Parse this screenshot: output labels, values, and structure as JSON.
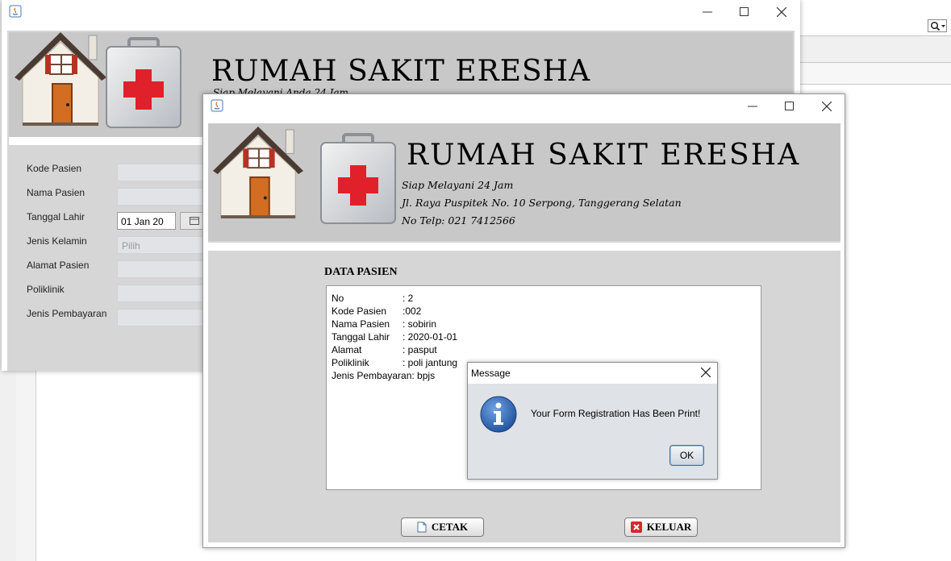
{
  "colors": {
    "panel": "#c8c8c8",
    "cross": "#e0202a",
    "info_blue": "#2f6fc4"
  },
  "back_window": {
    "hospital_name": "RUMAH SAKIT ERESHA",
    "tagline_partial": "Siap Melayani Anda 24 Jam",
    "form": {
      "labels": [
        "Kode Pasien",
        "Nama Pasien",
        "Tanggal Lahir",
        "Jenis Kelamin",
        "Alamat Pasien",
        "Poliklinik",
        "Jenis Pembayaran"
      ],
      "date_value": "01 Jan 20",
      "gender_placeholder": "Pilih"
    }
  },
  "front_window": {
    "hospital_name": "RUMAH SAKIT ERESHA",
    "tagline": "Siap Melayani 24 Jam",
    "address": "Jl. Raya Puspitek No. 10 Serpong, Tanggerang Selatan",
    "phone": "No Telp: 021 7412566",
    "data_title": "DATA PASIEN",
    "records": [
      {
        "key": "No",
        "value": ": 2"
      },
      {
        "key": "Kode Pasien",
        "value": ":002"
      },
      {
        "key": "Nama Pasien",
        "value": ": sobirin"
      },
      {
        "key": "Tanggal Lahir",
        "value": ": 2020-01-01"
      },
      {
        "key": "Alamat",
        "value": ": pasput"
      },
      {
        "key": "Poliklinik",
        "value": ": poli jantung"
      },
      {
        "key": "Jenis Pembayaran",
        "value": ": bpjs"
      }
    ],
    "buttons": {
      "print": "CETAK",
      "exit": "KELUAR"
    }
  },
  "dialog": {
    "title": "Message",
    "message": "Your Form Registration Has Been Print!",
    "ok": "OK"
  }
}
